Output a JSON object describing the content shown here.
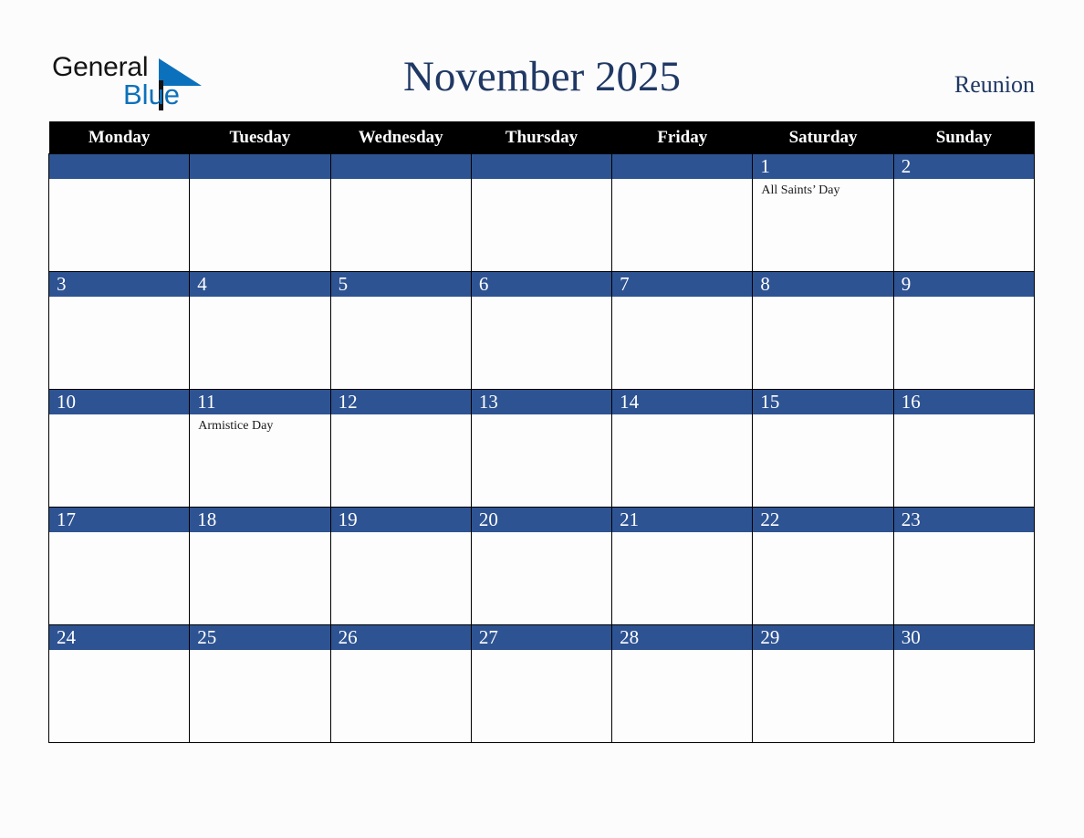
{
  "brand": {
    "word_one": "General",
    "word_two": "Blue",
    "triangle_color": "#0c71bc",
    "blue_text_color": "#0c71bc",
    "general_text_color": "#141414"
  },
  "header": {
    "title": "November 2025",
    "region": "Reunion",
    "title_color": "#203864"
  },
  "theme": {
    "header_row_background": "#000000",
    "header_row_text": "#ffffff",
    "date_bar_background": "#2e5392",
    "date_bar_text": "#ffffff",
    "cell_background": "#fdfdfd",
    "grid_line": "#000000",
    "page_background": "#fcfcfc"
  },
  "weekdays": [
    "Monday",
    "Tuesday",
    "Wednesday",
    "Thursday",
    "Friday",
    "Saturday",
    "Sunday"
  ],
  "weeks": [
    [
      {
        "day": "",
        "events": []
      },
      {
        "day": "",
        "events": []
      },
      {
        "day": "",
        "events": []
      },
      {
        "day": "",
        "events": []
      },
      {
        "day": "",
        "events": []
      },
      {
        "day": "1",
        "events": [
          "All Saints’ Day"
        ]
      },
      {
        "day": "2",
        "events": []
      }
    ],
    [
      {
        "day": "3",
        "events": []
      },
      {
        "day": "4",
        "events": []
      },
      {
        "day": "5",
        "events": []
      },
      {
        "day": "6",
        "events": []
      },
      {
        "day": "7",
        "events": []
      },
      {
        "day": "8",
        "events": []
      },
      {
        "day": "9",
        "events": []
      }
    ],
    [
      {
        "day": "10",
        "events": []
      },
      {
        "day": "11",
        "events": [
          "Armistice Day"
        ]
      },
      {
        "day": "12",
        "events": []
      },
      {
        "day": "13",
        "events": []
      },
      {
        "day": "14",
        "events": []
      },
      {
        "day": "15",
        "events": []
      },
      {
        "day": "16",
        "events": []
      }
    ],
    [
      {
        "day": "17",
        "events": []
      },
      {
        "day": "18",
        "events": []
      },
      {
        "day": "19",
        "events": []
      },
      {
        "day": "20",
        "events": []
      },
      {
        "day": "21",
        "events": []
      },
      {
        "day": "22",
        "events": []
      },
      {
        "day": "23",
        "events": []
      }
    ],
    [
      {
        "day": "24",
        "events": []
      },
      {
        "day": "25",
        "events": []
      },
      {
        "day": "26",
        "events": []
      },
      {
        "day": "27",
        "events": []
      },
      {
        "day": "28",
        "events": []
      },
      {
        "day": "29",
        "events": []
      },
      {
        "day": "30",
        "events": []
      }
    ]
  ]
}
